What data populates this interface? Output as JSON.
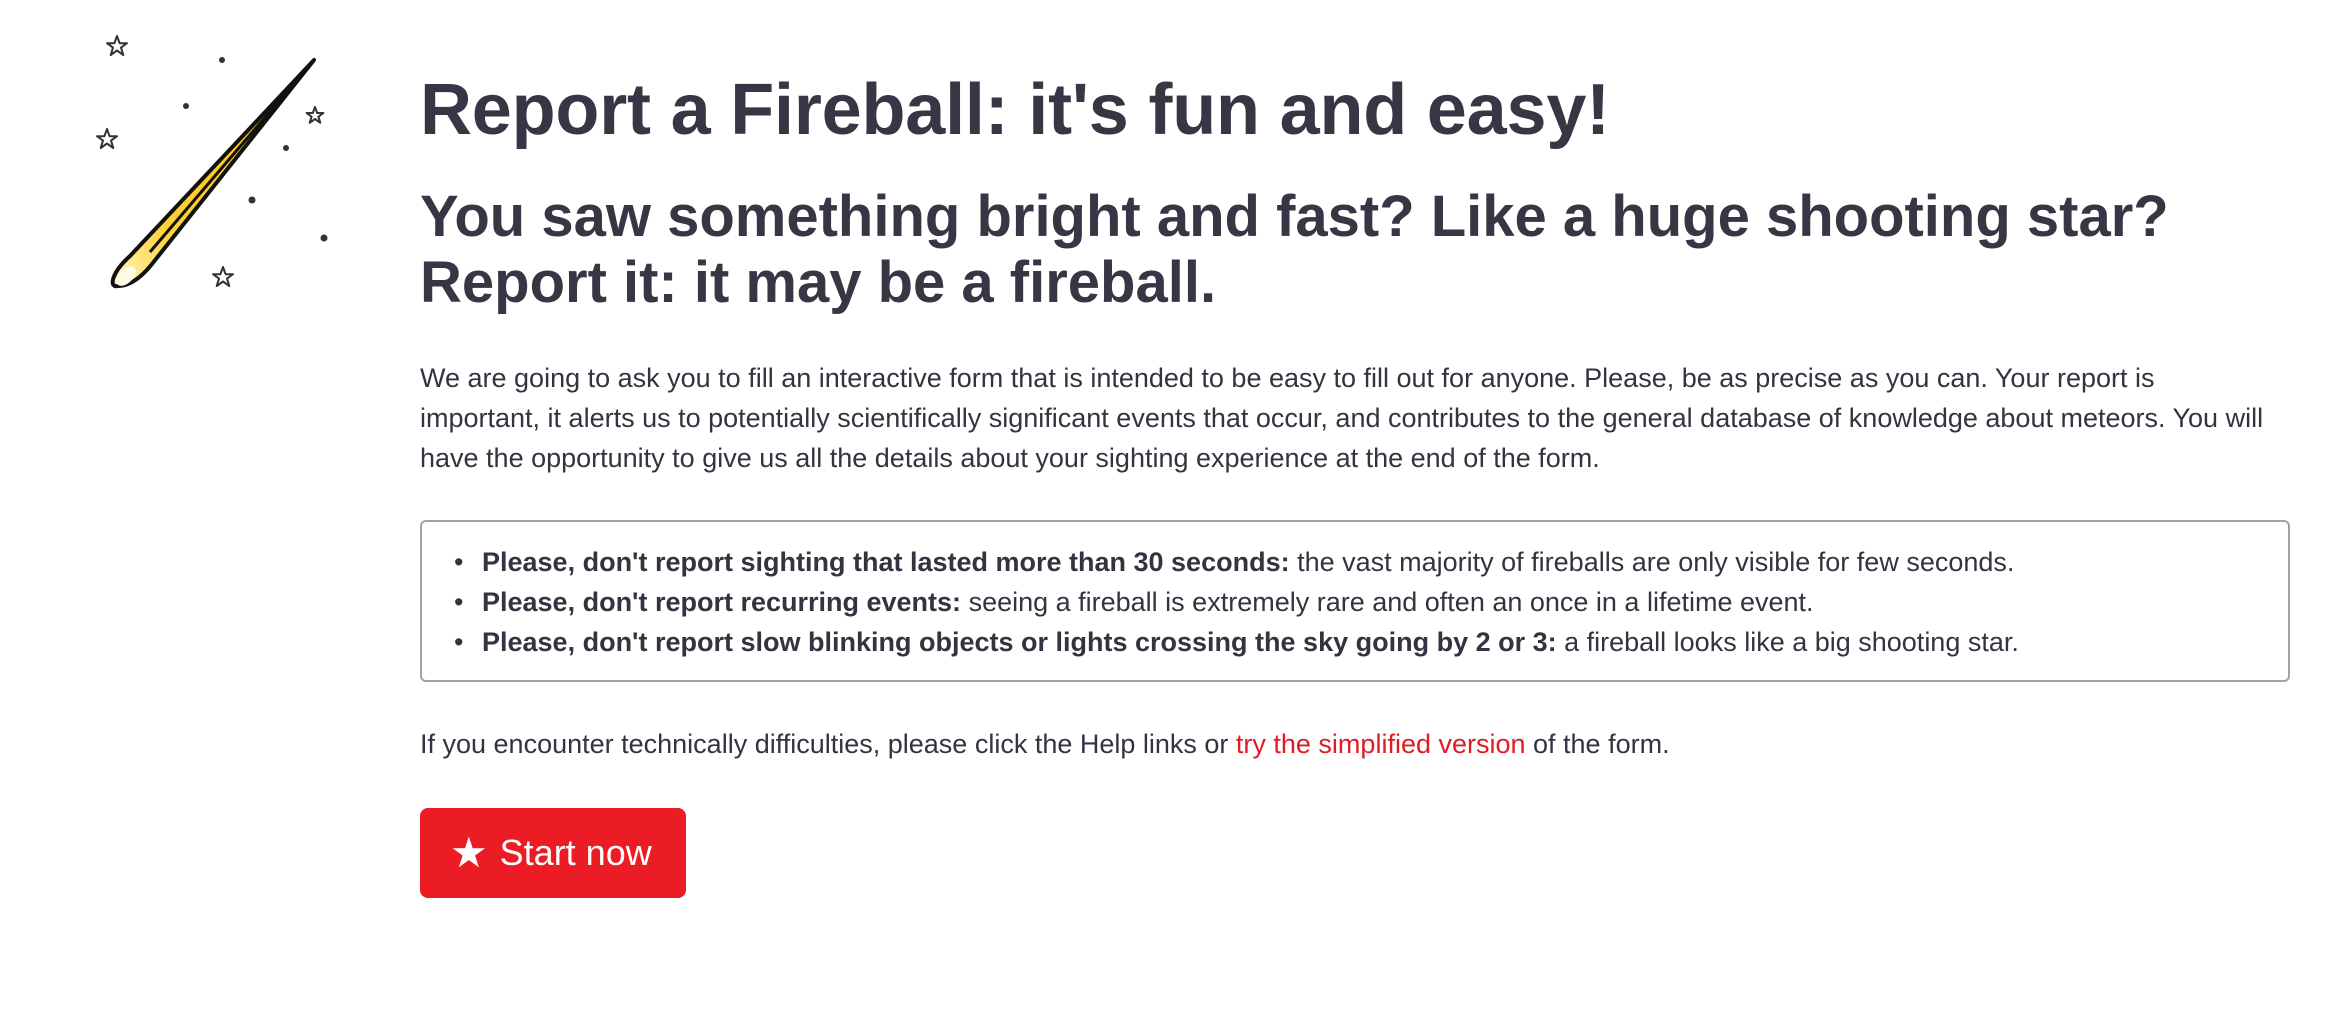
{
  "header": {
    "title": "Report a Fireball: it's fun and easy!",
    "subtitle_line1": "You saw something bright and fast? Like a huge shooting star?",
    "subtitle_line2": "Report it: it may be a fireball."
  },
  "intro": "We are going to ask you to fill an interactive form that is intended to be easy to fill out for anyone. Please, be as precise as you can. Your report is important, it alerts us to potentially scientifically significant events that occur, and contributes to the general database of knowledge about meteors. You will have the opportunity to give us all the details about your sighting experience at the end of the form.",
  "warnings": [
    {
      "bold": "Please, don't report sighting that lasted more than 30 seconds:",
      "text": " the vast majority of fireballs are only visible for few seconds."
    },
    {
      "bold": "Please, don't report recurring events:",
      "text": " seeing a fireball is extremely rare and often an once in a lifetime event."
    },
    {
      "bold": "Please, don't report slow blinking objects or lights crossing the sky going by 2 or 3:",
      "text": " a fireball looks like a big shooting star."
    }
  ],
  "help": {
    "before": "If you encounter technically difficulties, please click the Help links or ",
    "link": "try the simplified version",
    "after": " of the form."
  },
  "start_button": {
    "icon": "star-icon",
    "label": "Start now"
  },
  "logo": {
    "icon": "fireball-icon"
  },
  "colors": {
    "accent": "#ec1c24",
    "link": "#e01b24",
    "text": "#333341"
  }
}
